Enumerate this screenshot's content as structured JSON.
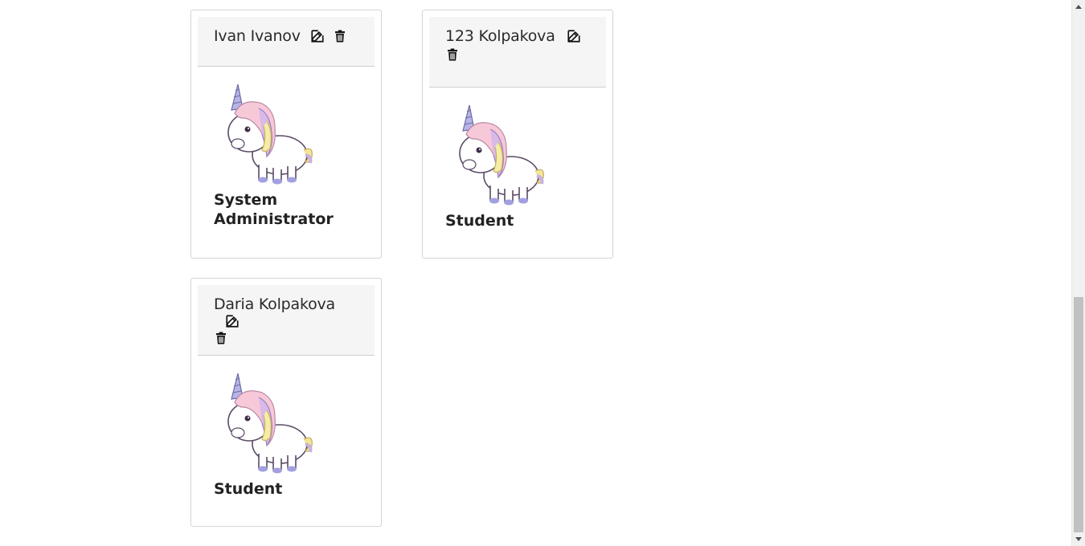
{
  "users": [
    {
      "name": "Ivan Ivanov",
      "role": "System Administrator"
    },
    {
      "name": "123 Kolpakova",
      "role": "Student"
    },
    {
      "name": "Daria Kolpakova",
      "role": "Student"
    }
  ],
  "icons": {
    "edit": "edit-icon",
    "delete": "trash-icon"
  },
  "colors": {
    "header_bg": "#f5f5f5",
    "card_border": "#d7d7d7"
  }
}
